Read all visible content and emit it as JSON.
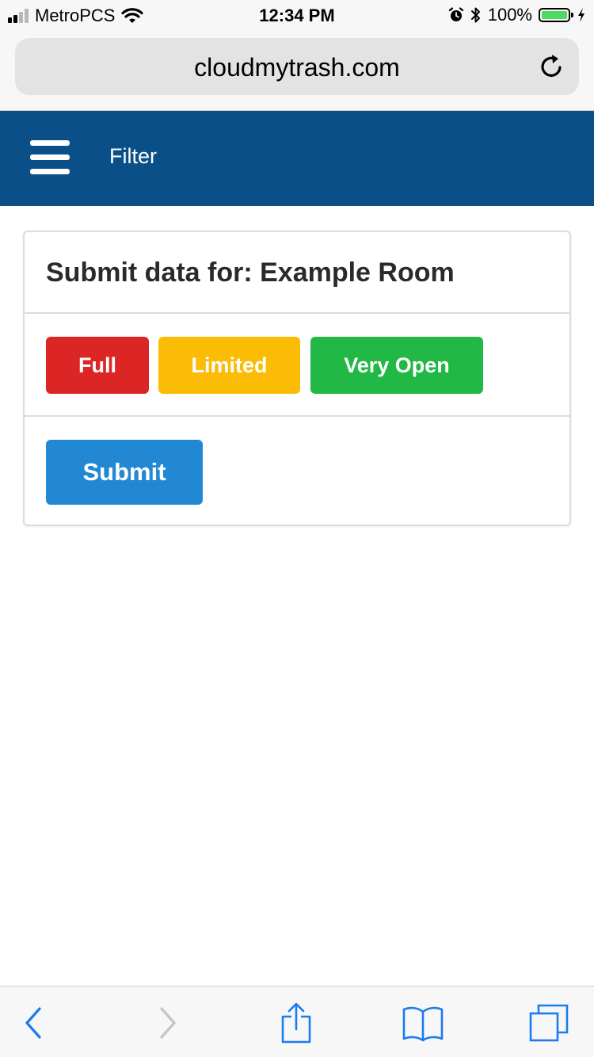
{
  "status_bar": {
    "carrier": "MetroPCS",
    "time": "12:34 PM",
    "battery": "100%",
    "battery_level": 1.0,
    "icons": [
      "signal-icon",
      "wifi-icon",
      "alarm-icon",
      "bluetooth-icon",
      "battery-icon",
      "charging-icon"
    ]
  },
  "browser": {
    "url": "cloudmytrash.com",
    "reload_icon": "reload-icon"
  },
  "navbar": {
    "menu_icon": "hamburger-menu-icon",
    "filter_label": "Filter",
    "background_color": "#0b4f89"
  },
  "card": {
    "title": "Submit data for: Example Room",
    "options": [
      {
        "label": "Full",
        "color": "#dc2626"
      },
      {
        "label": "Limited",
        "color": "#fbbc05"
      },
      {
        "label": "Very Open",
        "color": "#22b845"
      }
    ],
    "submit_label": "Submit",
    "submit_color": "#2388d4"
  },
  "toolbar": {
    "icons": [
      "back-icon",
      "forward-icon",
      "share-icon",
      "bookmarks-icon",
      "tabs-icon"
    ],
    "accent_color": "#1a7cf0"
  }
}
